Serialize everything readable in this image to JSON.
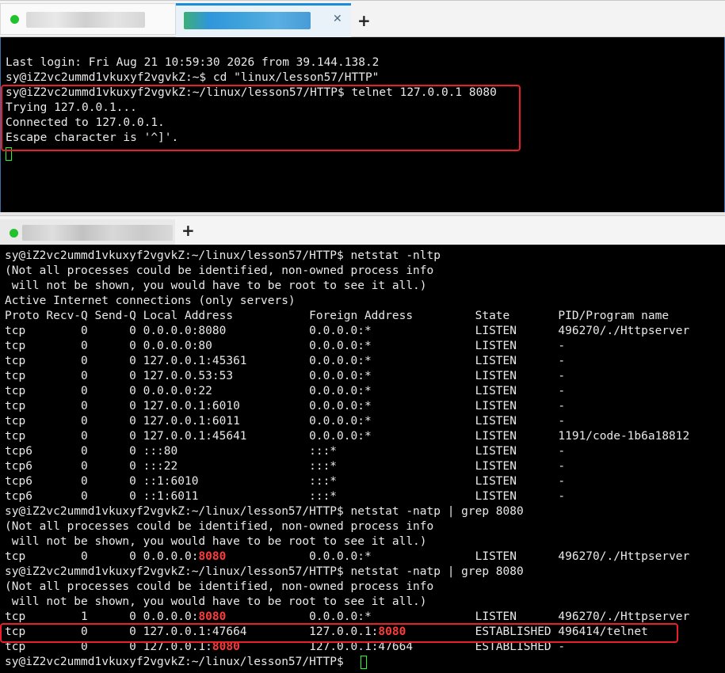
{
  "tabs_top": [
    {
      "status": "connected",
      "active": false,
      "title_blurred": true
    },
    {
      "status": "connected",
      "active": true,
      "title_blurred": true,
      "close_icon": "close-icon"
    }
  ],
  "tabs_bottom": [
    {
      "status": "connected",
      "active": true,
      "title_blurred": true
    }
  ],
  "add_tab_label": "+",
  "close_label": "✕",
  "colors": {
    "terminal_bg": "#000000",
    "terminal_fg": "#e9e9e9",
    "highlight": "#ff3b3b",
    "status_dot": "#22c22e",
    "annotation_box": "#e8202a",
    "active_tab": "#1a8cd8"
  },
  "top_terminal": {
    "lines": [
      "Last login: Fri Aug 21 10:59:30 2026 from 39.144.138.2",
      "sy@iZ2vc2ummd1vkuxyf2vgvkZ:~$ cd \"linux/lesson57/HTTP\"",
      "sy@iZ2vc2ummd1vkuxyf2vgvkZ:~/linux/lesson57/HTTP$ telnet 127.0.0.1 8080",
      "Trying 127.0.0.1...",
      "Connected to 127.0.0.1.",
      "Escape character is '^]'."
    ]
  },
  "bottom_terminal": {
    "cmd_netstat_nltp": "sy@iZ2vc2ummd1vkuxyf2vgvkZ:~/linux/lesson57/HTTP$ netstat -nltp",
    "warn1": "(Not all processes could be identified, non-owned process info",
    "warn2": " will not be shown, you would have to be root to see it all.)",
    "active_header": "Active Internet connections (only servers)",
    "table_header": "Proto Recv-Q Send-Q Local Address           Foreign Address         State       PID/Program name",
    "listen_rows": [
      "tcp        0      0 0.0.0.0:8080            0.0.0.0:*               LISTEN      496270/./Httpserver",
      "tcp        0      0 0.0.0.0:80              0.0.0.0:*               LISTEN      -",
      "tcp        0      0 127.0.0.1:45361         0.0.0.0:*               LISTEN      -",
      "tcp        0      0 127.0.0.53:53           0.0.0.0:*               LISTEN      -",
      "tcp        0      0 0.0.0.0:22              0.0.0.0:*               LISTEN      -",
      "tcp        0      0 127.0.0.1:6010          0.0.0.0:*               LISTEN      -",
      "tcp        0      0 127.0.0.1:6011          0.0.0.0:*               LISTEN      -",
      "tcp        0      0 127.0.0.1:45641         0.0.0.0:*               LISTEN      1191/code-1b6a18812",
      "tcp6       0      0 :::80                   :::*                    LISTEN      -",
      "tcp6       0      0 :::22                   :::*                    LISTEN      -",
      "tcp6       0      0 ::1:6010                :::*                    LISTEN      -",
      "tcp6       0      0 ::1:6011                :::*                    LISTEN      -"
    ],
    "cmd_grep": "sy@iZ2vc2ummd1vkuxyf2vgvkZ:~/linux/lesson57/HTTP$ netstat -natp | grep 8080",
    "grep1": [
      {
        "pre": "tcp        0      0 0.0.0.0:",
        "hl": "8080",
        "post": "            0.0.0.0:*               LISTEN      496270/./Httpserver"
      }
    ],
    "grep2": [
      {
        "pre": "tcp        1      0 0.0.0.0:",
        "hl": "8080",
        "post": "            0.0.0.0:*               LISTEN      496270/./Httpserver"
      },
      {
        "pre": "tcp        0      0 127.0.0.1:47664         127.0.0.1:",
        "hl": "8080",
        "post": "          ESTABLISHED 496414/telnet"
      },
      {
        "pre": "tcp        0      0 127.0.0.1:",
        "hl": "8080",
        "post": "          127.0.0.1:47664         ESTABLISHED -"
      }
    ],
    "prompt_final": "sy@iZ2vc2ummd1vkuxyf2vgvkZ:~/linux/lesson57/HTTP$ "
  }
}
